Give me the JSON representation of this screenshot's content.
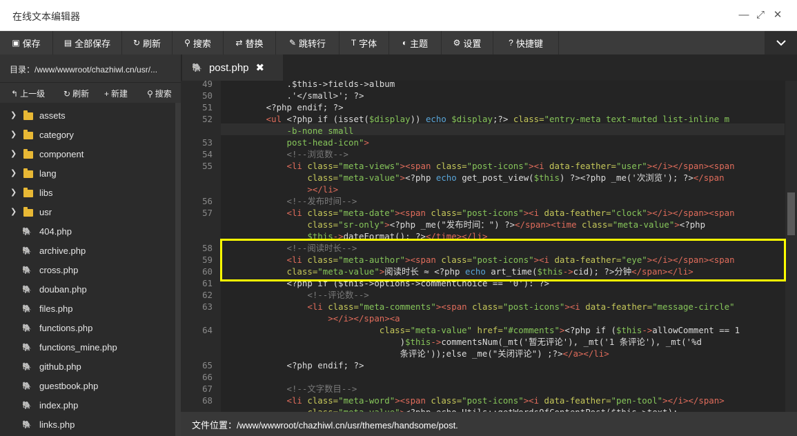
{
  "window": {
    "title": "在线文本编辑器"
  },
  "toolbar": [
    {
      "icon": "save-icon",
      "glyph": "▣",
      "label": "保存"
    },
    {
      "icon": "save-all-icon",
      "glyph": "▤",
      "label": "全部保存"
    },
    {
      "icon": "refresh-icon",
      "glyph": "↻",
      "label": "刷新"
    },
    {
      "icon": "search-icon",
      "glyph": "⚲",
      "label": "搜索"
    },
    {
      "icon": "replace-icon",
      "glyph": "⇄",
      "label": "替换"
    },
    {
      "icon": "pin-icon",
      "glyph": "✎",
      "label": "跳转行"
    },
    {
      "icon": "font-icon",
      "glyph": "T",
      "label": "字体"
    },
    {
      "icon": "theme-icon",
      "glyph": "◐",
      "label": "主题"
    },
    {
      "icon": "gear-icon",
      "glyph": "⚙",
      "label": "设置"
    },
    {
      "icon": "help-icon",
      "glyph": "?",
      "label": "快捷键"
    }
  ],
  "sidebar": {
    "directory": "目录：/www/wwwroot/chazhiwl.cn/usr/...",
    "tools": [
      {
        "icon": "up-level-icon",
        "glyph": "↰",
        "label": "上一级"
      },
      {
        "icon": "refresh-icon",
        "glyph": "↻",
        "label": "刷新"
      },
      {
        "icon": "plus-icon",
        "glyph": "+",
        "label": "新建"
      },
      {
        "icon": "search-icon",
        "glyph": "⚲",
        "label": "搜索"
      }
    ],
    "folders": [
      "assets",
      "category",
      "component",
      "lang",
      "libs",
      "usr"
    ],
    "files": [
      "404.php",
      "archive.php",
      "cross.php",
      "douban.php",
      "files.php",
      "functions.php",
      "functions_mine.php",
      "github.php",
      "guestbook.php",
      "index.php",
      "links.php"
    ]
  },
  "tab": {
    "label": "post.php",
    "close": "✖"
  },
  "status": {
    "path": "文件位置：/www/wwwroot/chazhiwl.cn/usr/themes/handsome/post."
  },
  "code_lines": [
    {
      "ln": "49",
      "segs": [
        [
          "p",
          "            .$this->fields->album"
        ]
      ]
    },
    {
      "ln": "50",
      "segs": [
        [
          "p",
          "            .'</small>'; ?>"
        ]
      ]
    },
    {
      "ln": "51",
      "segs": [
        [
          "p",
          "        <?php endif; ?>"
        ]
      ]
    },
    {
      "ln": "52",
      "segs": [
        [
          "t",
          "        <ul "
        ],
        [
          "p",
          "<?php if (isset("
        ],
        [
          "v",
          "$display"
        ],
        [
          "p",
          ")) "
        ],
        [
          "k",
          "echo "
        ],
        [
          "v",
          "$display"
        ],
        [
          "p",
          ";?> "
        ],
        [
          "a",
          "class="
        ],
        [
          "s",
          "\"entry-meta text-muted list-inline m"
        ]
      ]
    },
    {
      "ln": "",
      "segs": [
        [
          "s",
          "            -b-none small"
        ]
      ]
    },
    {
      "ln": "53",
      "segs": [
        [
          "s",
          "            post-head-icon\""
        ],
        [
          "t",
          ">"
        ]
      ]
    },
    {
      "ln": "54",
      "segs": [
        [
          "c",
          "            <!--浏览数-->"
        ]
      ]
    },
    {
      "ln": "55",
      "segs": [
        [
          "t",
          "            <li "
        ],
        [
          "a",
          "class="
        ],
        [
          "s",
          "\"meta-views\""
        ],
        [
          "t",
          "><span "
        ],
        [
          "a",
          "class="
        ],
        [
          "s",
          "\"post-icons\""
        ],
        [
          "t",
          "><i "
        ],
        [
          "a",
          "data-feather="
        ],
        [
          "s",
          "\"user\""
        ],
        [
          "t",
          "></i></span><span"
        ]
      ]
    },
    {
      "ln": "",
      "segs": [
        [
          "a",
          "                class="
        ],
        [
          "s",
          "\"meta-value\""
        ],
        [
          "t",
          ">"
        ],
        [
          "p",
          "<?php "
        ],
        [
          "k",
          "echo "
        ],
        [
          "p",
          "get_post_view("
        ],
        [
          "v",
          "$this"
        ],
        [
          "p",
          ") ?><?php _me('次浏览'); ?>"
        ],
        [
          "t",
          "</span"
        ]
      ]
    },
    {
      "ln": "",
      "segs": [
        [
          "t",
          "                ></li>"
        ]
      ]
    },
    {
      "ln": "56",
      "segs": [
        [
          "c",
          "            <!--发布时间-->"
        ]
      ]
    },
    {
      "ln": "57",
      "segs": [
        [
          "t",
          "            <li "
        ],
        [
          "a",
          "class="
        ],
        [
          "s",
          "\"meta-date\""
        ],
        [
          "t",
          "><span "
        ],
        [
          "a",
          "class="
        ],
        [
          "s",
          "\"post-icons\""
        ],
        [
          "t",
          "><i "
        ],
        [
          "a",
          "data-feather="
        ],
        [
          "s",
          "\"clock\""
        ],
        [
          "t",
          "></i></span><span"
        ]
      ]
    },
    {
      "ln": "",
      "segs": [
        [
          "a",
          "                class="
        ],
        [
          "s",
          "\"sr-only\""
        ],
        [
          "t",
          ">"
        ],
        [
          "p",
          "<?php _me(\"发布时间：\") ?>"
        ],
        [
          "t",
          "</span><time "
        ],
        [
          "a",
          "class="
        ],
        [
          "s",
          "\"meta-value\""
        ],
        [
          "t",
          ">"
        ],
        [
          "p",
          "<?php"
        ]
      ]
    },
    {
      "ln": "",
      "segs": [
        [
          "v",
          "                $this"
        ],
        [
          "o",
          "->"
        ],
        [
          "p",
          "dateFormat(): ?>"
        ],
        [
          "t",
          "</time></li>"
        ]
      ]
    },
    {
      "ln": "58",
      "segs": [
        [
          "c",
          "            <!--阅读时长-->"
        ]
      ]
    },
    {
      "ln": "59",
      "segs": [
        [
          "t",
          "            <li "
        ],
        [
          "a",
          "class="
        ],
        [
          "s",
          "\"meta-author\""
        ],
        [
          "t",
          "><span "
        ],
        [
          "a",
          "class="
        ],
        [
          "s",
          "\"post-icons\""
        ],
        [
          "t",
          "><i "
        ],
        [
          "a",
          "data-feather="
        ],
        [
          "s",
          "\"eye\""
        ],
        [
          "t",
          "></i></span><span"
        ]
      ]
    },
    {
      "ln": "60",
      "segs": [
        [
          "a",
          "            class="
        ],
        [
          "s",
          "\"meta-value\""
        ],
        [
          "t",
          ">"
        ],
        [
          "p",
          "阅读时长 ≈ <?php "
        ],
        [
          "k",
          "echo "
        ],
        [
          "p",
          "art_time("
        ],
        [
          "v",
          "$this"
        ],
        [
          "o",
          "->"
        ],
        [
          "p",
          "cid); ?>分钟"
        ],
        [
          "t",
          "</span></li>"
        ]
      ]
    },
    {
      "ln": "61",
      "segs": [
        [
          "p",
          "            <?php if ($this->options->commentChoice == '0'): ?>"
        ]
      ]
    },
    {
      "ln": "62",
      "segs": [
        [
          "c",
          "                <!--评论数-->"
        ]
      ]
    },
    {
      "ln": "63",
      "segs": [
        [
          "t",
          "                <li "
        ],
        [
          "a",
          "class="
        ],
        [
          "s",
          "\"meta-comments\""
        ],
        [
          "t",
          "><span "
        ],
        [
          "a",
          "class="
        ],
        [
          "s",
          "\"post-icons\""
        ],
        [
          "t",
          "><i "
        ],
        [
          "a",
          "data-feather="
        ],
        [
          "s",
          "\"message-circle\""
        ]
      ]
    },
    {
      "ln": "",
      "segs": [
        [
          "t",
          "                    ></i></span><a"
        ]
      ]
    },
    {
      "ln": "64",
      "segs": [
        [
          "a",
          "                              class="
        ],
        [
          "s",
          "\"meta-value\" "
        ],
        [
          "a",
          "href="
        ],
        [
          "s",
          "\"#comments\""
        ],
        [
          "t",
          ">"
        ],
        [
          "p",
          "<?php if ("
        ],
        [
          "v",
          "$this"
        ],
        [
          "o",
          "->"
        ],
        [
          "p",
          "allowComment == "
        ],
        [
          "n",
          "1"
        ]
      ]
    },
    {
      "ln": "",
      "segs": [
        [
          "p",
          "                                  )"
        ],
        [
          "v",
          "$this"
        ],
        [
          "o",
          "->"
        ],
        [
          "p",
          "commentsNum(_mt('暂无评论'), _mt('1 条评论'), _mt('%d"
        ]
      ]
    },
    {
      "ln": "",
      "segs": [
        [
          "p",
          "                                  条评论'));else _me(\"关闭评论\") ;?>"
        ],
        [
          "t",
          "</a></li>"
        ]
      ]
    },
    {
      "ln": "65",
      "segs": [
        [
          "p",
          "            <?php endif; ?>"
        ]
      ]
    },
    {
      "ln": "66",
      "segs": [
        [
          "p",
          ""
        ]
      ]
    },
    {
      "ln": "67",
      "segs": [
        [
          "c",
          "            <!--文字数目-->"
        ]
      ]
    },
    {
      "ln": "68",
      "segs": [
        [
          "t",
          "            <li "
        ],
        [
          "a",
          "class="
        ],
        [
          "s",
          "\"meta-word\""
        ],
        [
          "t",
          "><span "
        ],
        [
          "a",
          "class="
        ],
        [
          "s",
          "\"post-icons\""
        ],
        [
          "t",
          "><i "
        ],
        [
          "a",
          "data-feather="
        ],
        [
          "s",
          "\"pen-tool\""
        ],
        [
          "t",
          "></i></span>"
        ]
      ]
    },
    {
      "ln": "",
      "segs": [
        [
          "a",
          "                class="
        ],
        [
          "s",
          "\"meta-value\""
        ],
        [
          "t",
          ">"
        ],
        [
          "p",
          "<?php echo Utils::getWordsOfContentPost($this->text);"
        ]
      ]
    }
  ],
  "accent": {
    "highlight_box": "#ffff00",
    "folder": "#e8b835",
    "file_icon": "#5a8ab0"
  }
}
